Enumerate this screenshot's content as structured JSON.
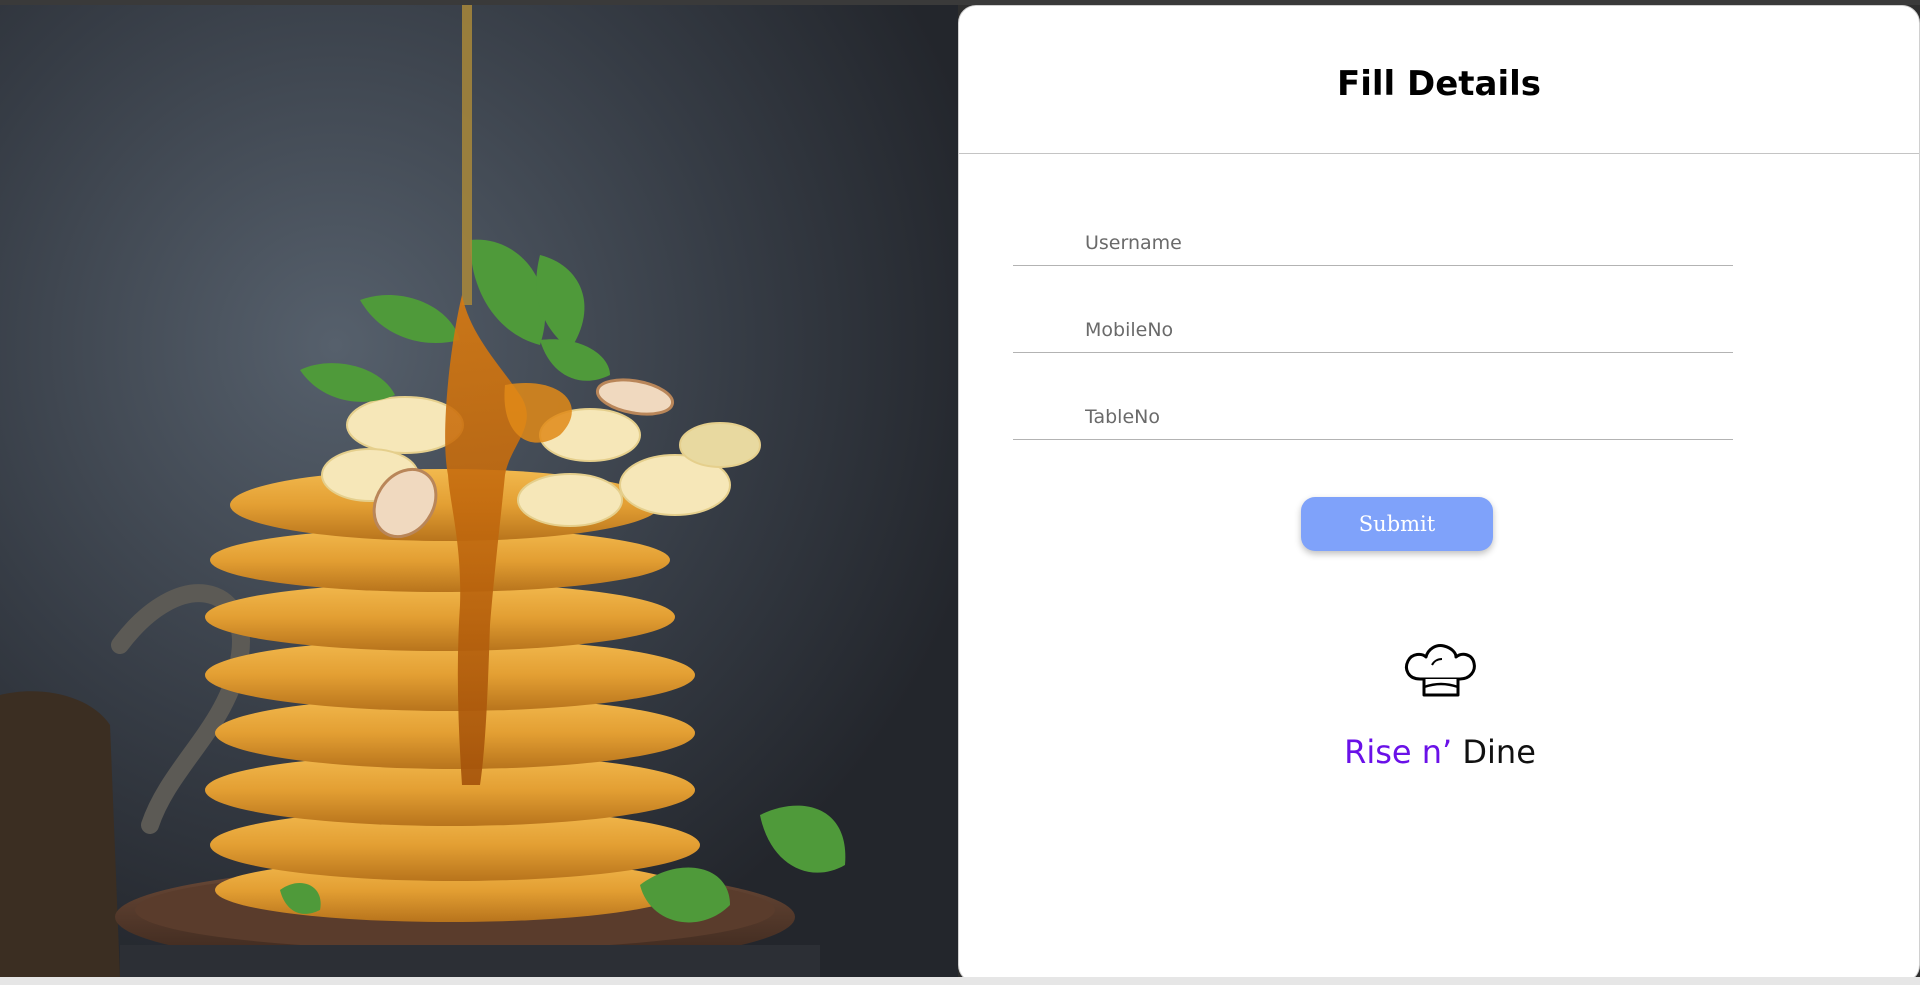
{
  "form": {
    "title": "Fill Details",
    "fields": [
      {
        "name": "username",
        "placeholder": "Username",
        "value": ""
      },
      {
        "name": "mobile",
        "placeholder": "MobileNo",
        "value": ""
      },
      {
        "name": "table",
        "placeholder": "TableNo",
        "value": ""
      }
    ],
    "submit_label": "Submit"
  },
  "brand": {
    "accent_text": "Rise n’",
    "rest_text": "Dine",
    "accent_color": "#6a11e8",
    "icon": "chef-hat-icon"
  },
  "theme": {
    "button_color": "#7fa2fa",
    "panel_background": "#ffffff"
  },
  "photo": {
    "icon": "pancake-stack-photo"
  }
}
